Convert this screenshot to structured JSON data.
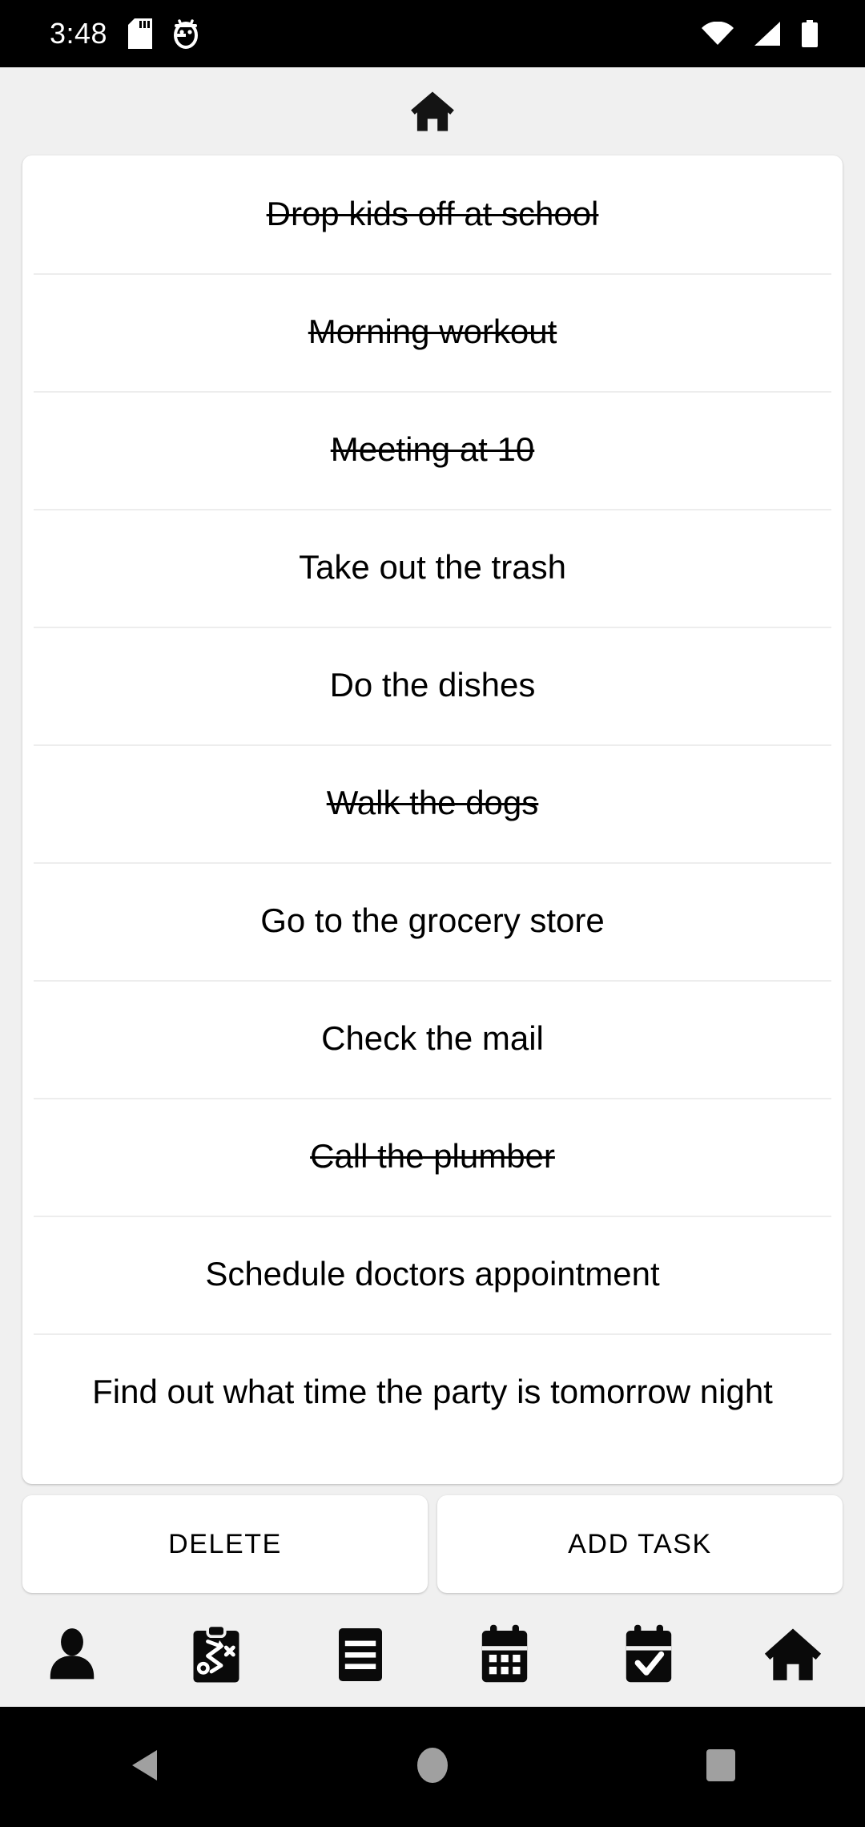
{
  "status_bar": {
    "time": "3:48",
    "left_icons": [
      "sd-card-icon",
      "android-debug-icon"
    ],
    "right_icons": [
      "wifi-icon",
      "cell-signal-icon",
      "battery-icon"
    ],
    "background_color": "#000000",
    "foreground_color": "#FFFFFF"
  },
  "header": {
    "icon": "home-icon"
  },
  "colors": {
    "page_background": "#F0F0F0",
    "card_background": "#FFFFFF",
    "divider": "#EDEDED",
    "text": "#000000",
    "sysnav_icon": "#A0A0A0"
  },
  "task_list": {
    "items": [
      {
        "label": "Drop kids off at school",
        "completed": true
      },
      {
        "label": "Morning workout",
        "completed": true
      },
      {
        "label": "Meeting at 10",
        "completed": true
      },
      {
        "label": "Take out the trash",
        "completed": false
      },
      {
        "label": "Do the dishes",
        "completed": false
      },
      {
        "label": "Walk the dogs",
        "completed": true
      },
      {
        "label": "Go to the grocery store",
        "completed": false
      },
      {
        "label": "Check the mail",
        "completed": false
      },
      {
        "label": "Call the plumber",
        "completed": true
      },
      {
        "label": "Schedule doctors appointment",
        "completed": false
      },
      {
        "label": "Find out what time the party is tomorrow night",
        "completed": false
      }
    ]
  },
  "actions": {
    "delete_label": "DELETE",
    "add_task_label": "ADD TASK"
  },
  "bottom_nav": {
    "items": [
      {
        "icon": "person-icon"
      },
      {
        "icon": "clipboard-playbook-icon"
      },
      {
        "icon": "list-icon"
      },
      {
        "icon": "calendar-icon"
      },
      {
        "icon": "calendar-check-icon"
      },
      {
        "icon": "home-icon"
      }
    ]
  },
  "system_nav": {
    "back": "back-triangle-icon",
    "home": "home-circle-icon",
    "recents": "recents-square-icon"
  }
}
